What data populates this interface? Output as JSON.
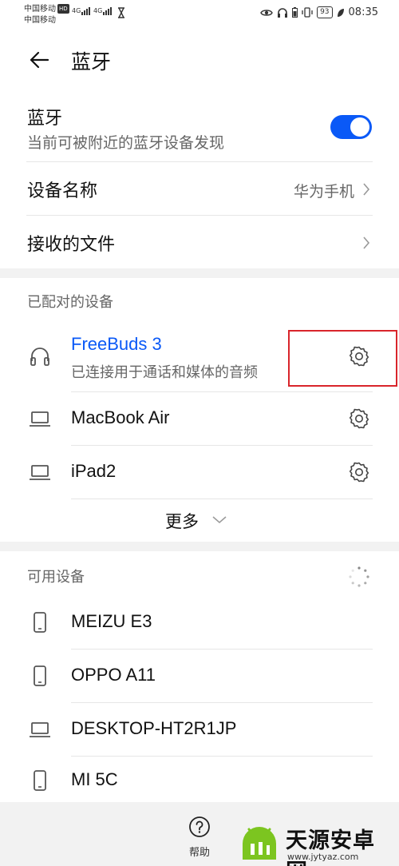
{
  "status_bar": {
    "carrier1": "中国移动",
    "carrier1_badge": "HD",
    "carrier2": "中国移动",
    "signal1": "4G",
    "signal2": "4G",
    "battery": "93",
    "time": "08:35"
  },
  "header": {
    "title": "蓝牙"
  },
  "bluetooth": {
    "label": "蓝牙",
    "description": "当前可被附近的蓝牙设备发现",
    "enabled": true,
    "accent_color": "#0a59f7"
  },
  "device_name": {
    "label": "设备名称",
    "value": "华为手机"
  },
  "received_files": {
    "label": "接收的文件"
  },
  "paired": {
    "header": "已配对的设备",
    "devices": [
      {
        "name": "FreeBuds 3",
        "status": "已连接用于通话和媒体的音频",
        "icon": "headphones-icon",
        "connected_color": "#0a59f7"
      },
      {
        "name": "MacBook Air",
        "icon": "laptop-icon"
      },
      {
        "name": "iPad2",
        "icon": "laptop-icon"
      }
    ],
    "more_label": "更多"
  },
  "available": {
    "header": "可用设备",
    "devices": [
      {
        "name": "MEIZU E3",
        "icon": "phone-icon"
      },
      {
        "name": "OPPO A11",
        "icon": "phone-icon"
      },
      {
        "name": "DESKTOP-HT2R1JP",
        "icon": "laptop-icon"
      },
      {
        "name": "MI 5C",
        "icon": "phone-icon"
      }
    ]
  },
  "bottom": {
    "help_label": "帮助"
  },
  "watermark": {
    "title": "天源安卓网",
    "url": "www.jytyaz.com"
  },
  "annotation_color": "#d9252b"
}
